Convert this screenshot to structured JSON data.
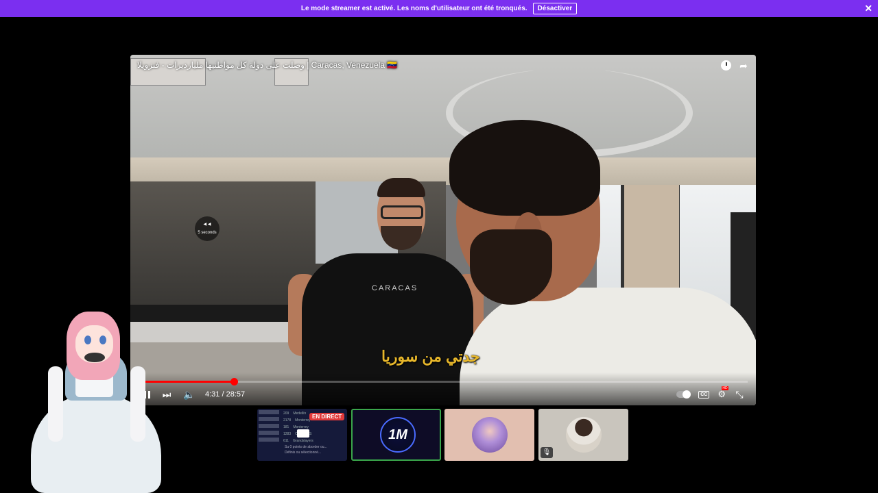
{
  "banner": {
    "message": "Le mode streamer est activé. Les noms d'utilisateur ont été tronqués.",
    "button_label": "Désactiver",
    "close_glyph": "✕"
  },
  "video": {
    "title": "وصلت على دولة كل مواطنيها مليارديرات - فنزويلا | Caracas, Venezuela 🇻🇪",
    "subtitle": "جدتي من سوريا",
    "shirt_text": "CARACAS",
    "skip_hint": "5 seconds",
    "time": "4:31 / 28:57",
    "progress": 0.156,
    "hd_badge": "HD",
    "cc_label": "CC",
    "icons": [
      "clock-icon",
      "share-icon",
      "pause-icon",
      "next-icon",
      "volume-icon",
      "autoplay-toggle-icon",
      "cc-icon",
      "settings-icon",
      "fullscreen-exit-icon"
    ]
  },
  "participants": {
    "tile1": {
      "live_label": "EN DIRECT",
      "rows": [
        {
          "num": "209",
          "name": "Medellín"
        },
        {
          "num": "2178",
          "name": "Monterrey"
        },
        {
          "num": "181",
          "name": "Monterrey"
        },
        {
          "num": "1283",
          "name": "CARACAS"
        },
        {
          "num": "611",
          "name": "Grandslayers"
        }
      ],
      "footer_line1": "Su 0 points de aborder ou...",
      "footer_line2": "Définis ou sélectionné..."
    },
    "tile2": {
      "logo_text": "1M"
    },
    "tile3": {},
    "tile4": {
      "mute_glyph": "🎙"
    }
  },
  "colors": {
    "banner": "#7b2ff0",
    "progress": "#ff0000",
    "subtitle": "#e7b72b",
    "active_tile_border": "#3aa64b",
    "live_badge": "#e03a3a"
  }
}
